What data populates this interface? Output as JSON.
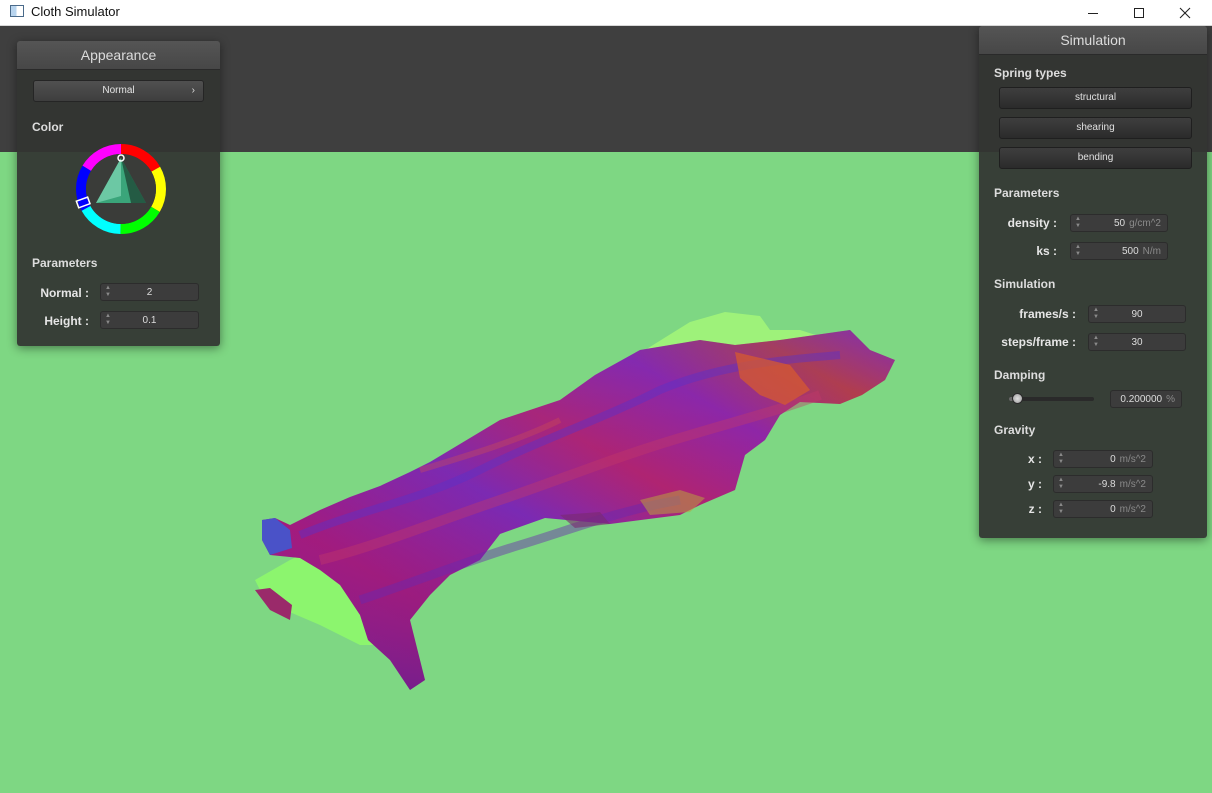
{
  "window": {
    "title": "Cloth Simulator",
    "icon": "app-window-icon"
  },
  "appearance": {
    "title": "Appearance",
    "shader_selected": "Normal",
    "color_label": "Color",
    "color_picker_icon": "color-wheel-icon",
    "params_label": "Parameters",
    "normal_label": "Normal :",
    "normal_value": "2",
    "height_label": "Height :",
    "height_value": "0.1"
  },
  "simulation": {
    "title": "Simulation",
    "spring_types_label": "Spring types",
    "spring_buttons": [
      "structural",
      "shearing",
      "bending"
    ],
    "parameters_label": "Parameters",
    "density_label": "density :",
    "density_value": "50",
    "density_unit": "g/cm^2",
    "ks_label": "ks :",
    "ks_value": "500",
    "ks_unit": "N/m",
    "simulation_label": "Simulation",
    "fps_label": "frames/s :",
    "fps_value": "90",
    "steps_label": "steps/frame :",
    "steps_value": "30",
    "damping_label": "Damping",
    "damping_value": "0.200000",
    "damping_unit": "%",
    "damping_slider_fraction": 0.1,
    "gravity_label": "Gravity",
    "gx_label": "x :",
    "gx_value": "0",
    "gy_label": "y :",
    "gy_value": "-9.8",
    "gz_label": "z :",
    "gz_value": "0",
    "gravity_unit": "m/s^2"
  },
  "colors": {
    "background": "#7ed783",
    "panel": "#333532",
    "sky": "#3f3f3f"
  }
}
